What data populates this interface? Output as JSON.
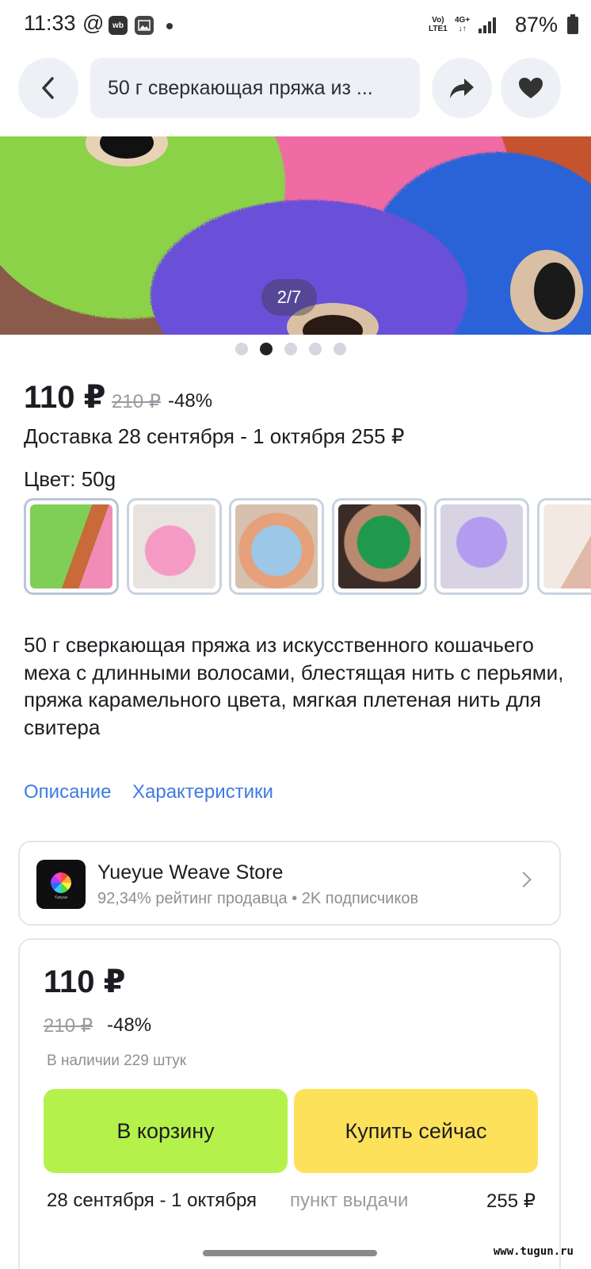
{
  "status_bar": {
    "time": "11:33",
    "at_symbol": "@",
    "wb_badge": "wb",
    "network_top": "Vo)",
    "network_bottom": "LTE1",
    "net_type_top": "4G+",
    "net_type_bottom": "↓↑",
    "battery": "87%"
  },
  "header": {
    "search_text": "50 г сверкающая пряжа из ...",
    "icons": [
      "back-icon",
      "share-icon",
      "heart-icon"
    ]
  },
  "gallery": {
    "counter": "2/7",
    "dots": 5,
    "active_dot": 1
  },
  "product": {
    "price": "110 ₽",
    "old_price": "210 ₽",
    "discount": "-48%",
    "delivery": "Доставка 28 сентября - 1 октября 255 ₽",
    "color_label": "Цвет: 50g",
    "swatches": [
      "green",
      "pink",
      "light-blue",
      "dark-green",
      "lavender",
      "white"
    ],
    "title": "50 г сверкающая пряжа из искусственного кошачьего меха с длинными волосами, блестящая нить с перьями, пряжа карамельного цвета, мягкая плетеная нить для свитера",
    "tabs": {
      "description": "Описание",
      "specs": "Характеристики"
    }
  },
  "seller": {
    "name": "Yueyue Weave Store",
    "info": "92,34% рейтинг продавца • 2K подписчиков",
    "logo_text": "Yueyue"
  },
  "buy": {
    "price": "110 ₽",
    "old_price": "210 ₽",
    "discount": "-48%",
    "stock": "В наличии 229 штук",
    "cart_button": "В корзину",
    "buy_button": "Купить сейчас",
    "delivery_dates": "28 сентября - 1 октября",
    "delivery_point": "пункт выдачи",
    "delivery_price": "255 ₽"
  },
  "watermark": "www.tugun.ru",
  "colors": {
    "cart_green": "#b5f14b",
    "buy_yellow": "#fde15a",
    "link_blue": "#3d7be0",
    "chip_bg": "#edf0f5"
  }
}
